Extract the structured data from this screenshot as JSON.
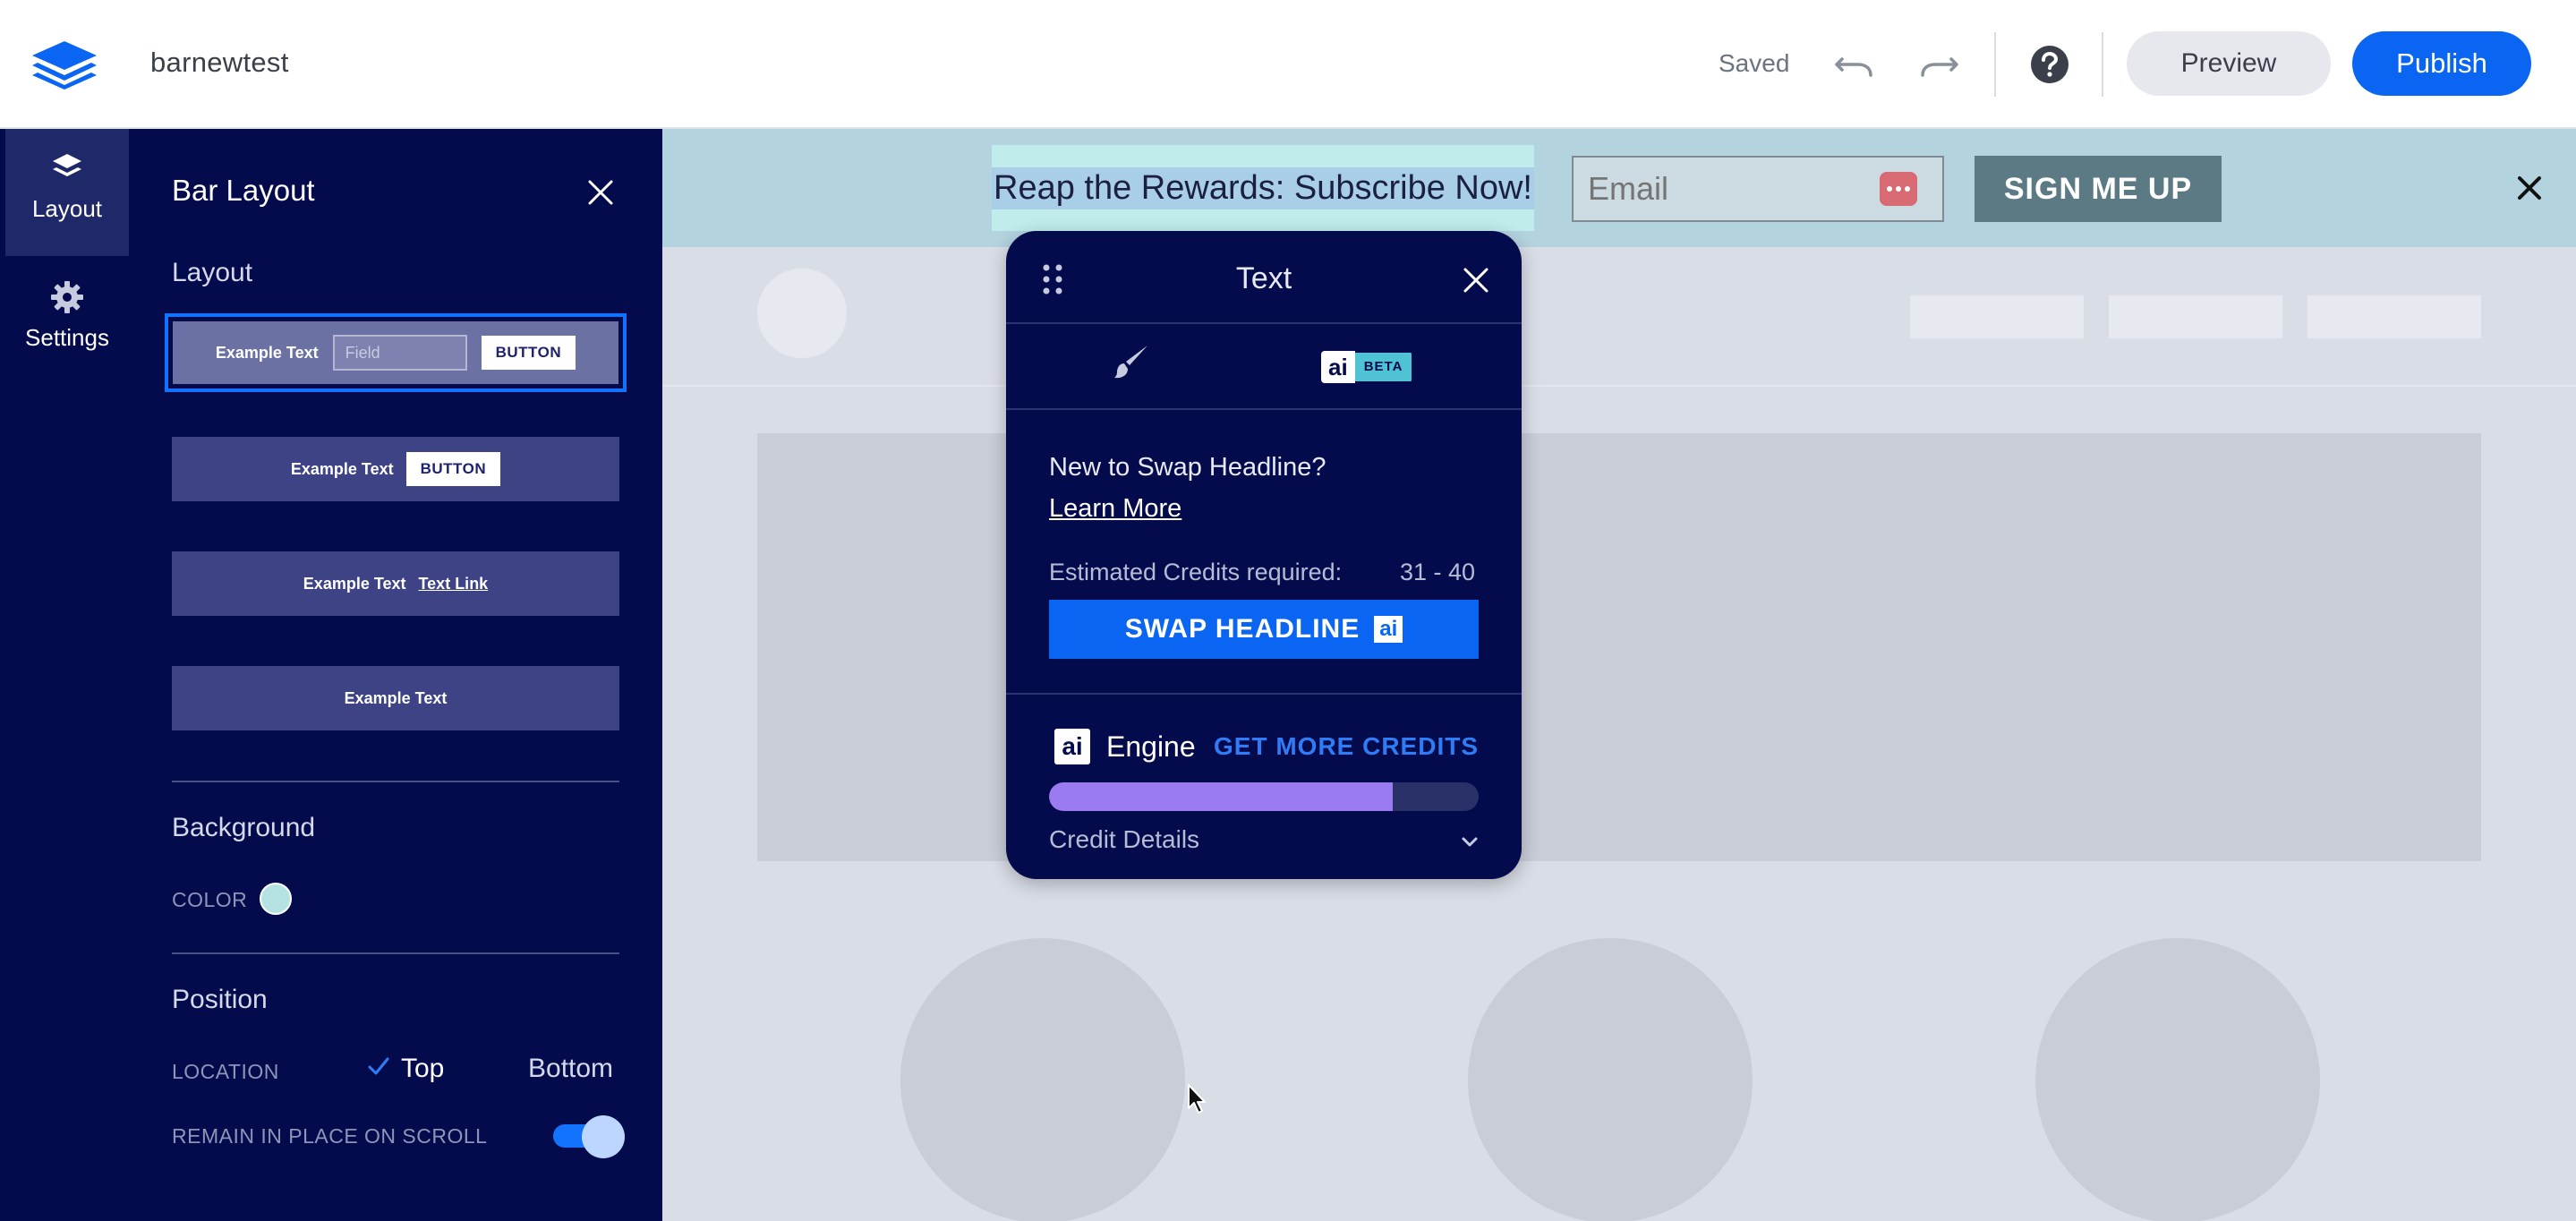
{
  "header": {
    "site_name": "barnewtest",
    "saved_label": "Saved",
    "preview_label": "Preview",
    "publish_label": "Publish",
    "icons": [
      "layers-logo-icon",
      "undo-icon",
      "redo-icon",
      "help-icon"
    ]
  },
  "rail": {
    "items": [
      {
        "label": "Layout",
        "icon": "layers-icon",
        "active": true
      },
      {
        "label": "Settings",
        "icon": "gear-icon",
        "active": false
      }
    ]
  },
  "panel": {
    "title": "Bar Layout",
    "layout_section": "Layout",
    "layout_options": [
      {
        "text": "Example Text",
        "field": "Field",
        "button": "BUTTON"
      },
      {
        "text": "Example Text",
        "button": "BUTTON"
      },
      {
        "text": "Example Text",
        "link": "Text Link"
      },
      {
        "text": "Example Text"
      }
    ],
    "background_section": "Background",
    "color_label": "COLOR",
    "background_color": "#b5e3e3",
    "position_section": "Position",
    "location_label": "LOCATION",
    "location_top": "Top",
    "location_bottom": "Bottom",
    "location_selected": "Top",
    "remain_label": "REMAIN IN PLACE ON SCROLL",
    "remain_enabled": true
  },
  "canvas": {
    "headline": "Reap the Rewards: Subscribe Now!",
    "email_placeholder": "Email",
    "signup_label": "SIGN ME UP",
    "bar_color": "#b3d3de"
  },
  "popover": {
    "title": "Text",
    "ai_badge": "ai",
    "beta_badge": "BETA",
    "intro": "New to Swap Headline?",
    "learn_more": "Learn More",
    "credits_label": "Estimated Credits required:",
    "credits_value": "31 - 40",
    "swap_label": "SWAP HEADLINE",
    "swap_ai": "ai",
    "engine_ai": "ai",
    "engine_label": "Engine",
    "get_credits": "GET MORE CREDITS",
    "credit_fraction": 0.8,
    "credit_details": "Credit Details"
  },
  "colors": {
    "accent": "#0a66f2",
    "sidebar": "#030b4c",
    "credit_fill": "#9b7bf0"
  }
}
